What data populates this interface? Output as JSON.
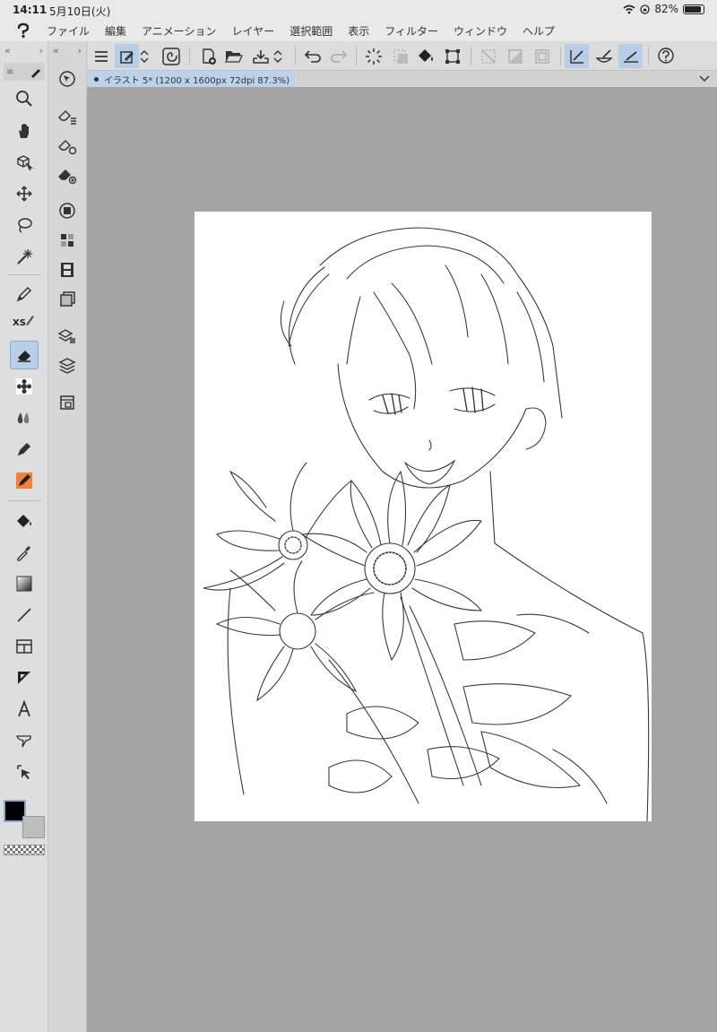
{
  "status": {
    "time": "14:11",
    "date": "5月10日(火)",
    "battery": "82%",
    "battery_level": 0.82
  },
  "menu": {
    "items": [
      "ファイル",
      "編集",
      "アニメーション",
      "レイヤー",
      "選択範囲",
      "表示",
      "フィルター",
      "ウィンドウ",
      "ヘルプ"
    ]
  },
  "document_tab": {
    "title": "イラスト 5* (1200 x 1600px 72dpi 87.3%)"
  },
  "tools": {
    "xs_label": "XS",
    "items": [
      "zoom",
      "hand",
      "object",
      "move",
      "lasso-select",
      "magic-wand",
      "pen",
      "pencil-xs",
      "eraser",
      "decoration",
      "blend",
      "marker",
      "fill-pen",
      "fill",
      "eyedropper",
      "gradient",
      "line",
      "frame",
      "ruler",
      "text",
      "balloon",
      "correct-line"
    ],
    "active": "eraser"
  },
  "colors": {
    "main": "#000000",
    "sub": "#bdbdbd",
    "accent": "#b8cde6",
    "canvas_bg": "#a4a4a4"
  }
}
